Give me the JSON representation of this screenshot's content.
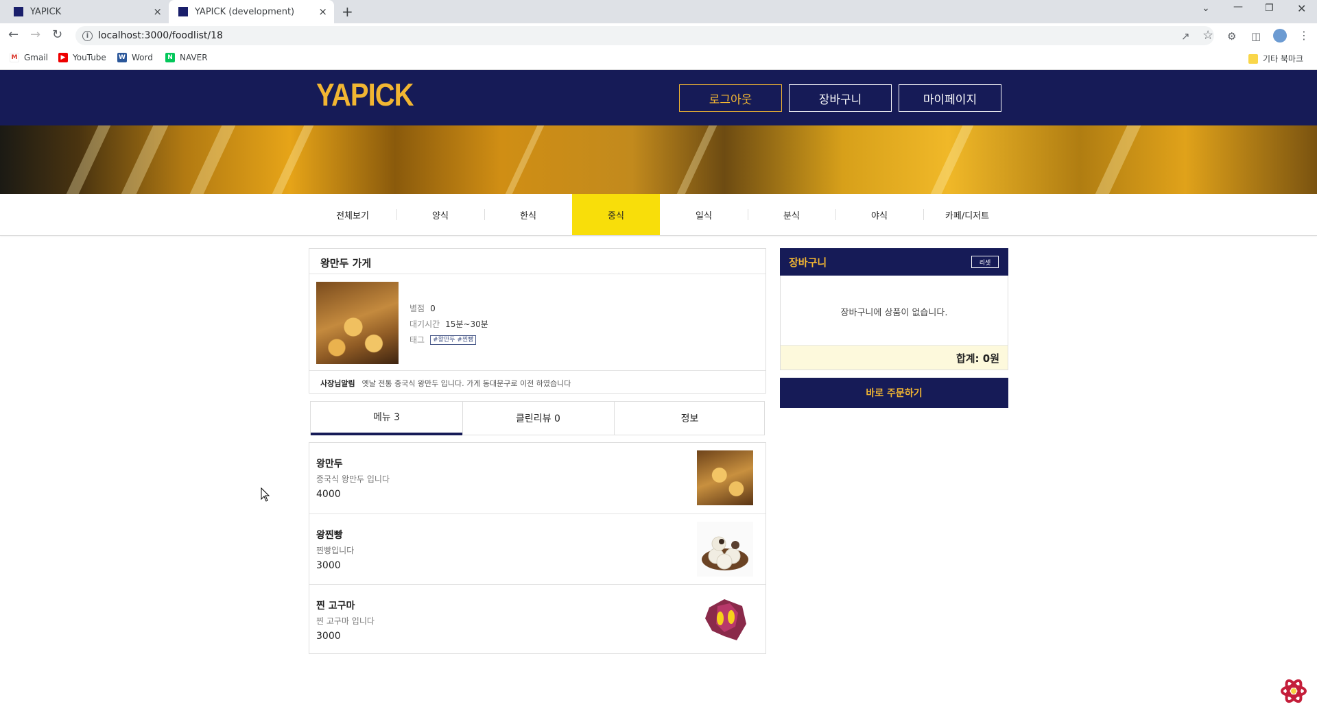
{
  "browser": {
    "tabs": [
      {
        "title": "YAPICK",
        "close": "×"
      },
      {
        "title": "YAPICK (development)",
        "close": "×"
      }
    ],
    "new_tab": "+",
    "url": "localhost:3000/foodlist/18",
    "bookmarks": [
      {
        "label": "Gmail",
        "icon": "gmail-icon"
      },
      {
        "label": "YouTube",
        "icon": "youtube-icon"
      },
      {
        "label": "Word",
        "icon": "word-icon"
      },
      {
        "label": "NAVER",
        "icon": "naver-icon"
      }
    ],
    "other_bookmarks": "기타 북마크"
  },
  "header": {
    "logo": "YAPICK",
    "buttons": {
      "logout": "로그아웃",
      "cart": "장바구니",
      "mypage": "마이페이지"
    }
  },
  "categories": [
    "전체보기",
    "양식",
    "한식",
    "중식",
    "일식",
    "분식",
    "야식",
    "카페/디저트"
  ],
  "active_category": "중식",
  "store": {
    "name": "왕만두 가게",
    "rating_label": "별점",
    "rating": "0",
    "wait_label": "대기시간",
    "wait": "15분~30분",
    "tag_label": "태그",
    "tags": "#왕만두 #찐빵",
    "notice_label": "사장님알림",
    "notice": "옛날 전통 중국식 왕만두 입니다. 가게 동대문구로 이전 하였습니다"
  },
  "tabs": {
    "menu": "메뉴 3",
    "review": "클린리뷰 0",
    "info": "정보"
  },
  "menu_items": [
    {
      "name": "왕만두",
      "desc": "중국식 왕만두 입니다",
      "price": "4000"
    },
    {
      "name": "왕찐빵",
      "desc": "찐빵입니다",
      "price": "3000"
    },
    {
      "name": "찐 고구마",
      "desc": "찐 고구마 입니다",
      "price": "3000"
    }
  ],
  "cart": {
    "title": "장바구니",
    "reset": "리셋",
    "empty": "장바구니에 상품이 없습니다.",
    "total": "합계: 0원",
    "order": "바로 주문하기"
  },
  "colors": {
    "navy": "#161b57",
    "gold": "#f2b632",
    "active_category": "#f8de0a"
  }
}
